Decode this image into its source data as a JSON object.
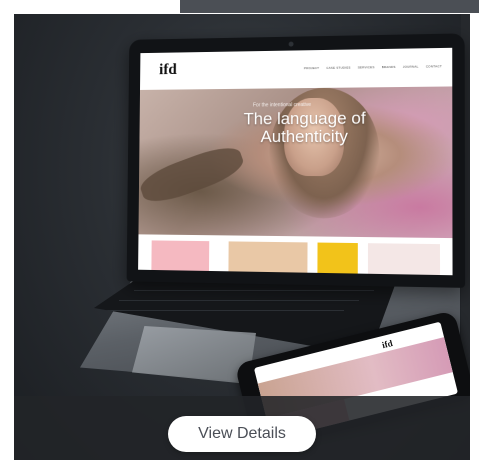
{
  "laptop_site": {
    "logo": "ifd",
    "nav": [
      "PROJECT",
      "CASE STUDIES",
      "SERVICES",
      "BRANDS",
      "JOURNAL",
      "CONTACT"
    ],
    "hero_kicker": "For the intentional creative",
    "hero_title": "The language of Authenticity"
  },
  "phone_site": {
    "logo": "ifd"
  },
  "cta": {
    "label": "View Details"
  }
}
